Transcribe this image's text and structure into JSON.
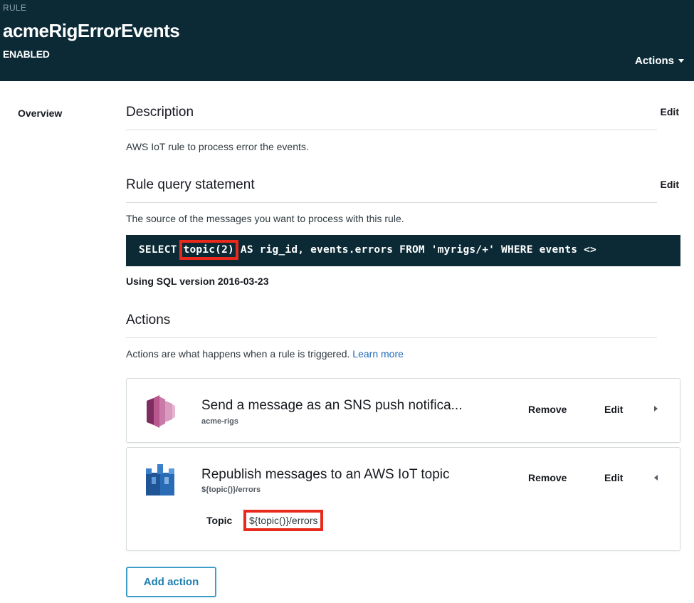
{
  "header": {
    "crumb": "RULE",
    "title": "acmeRigErrorEvents",
    "status": "ENABLED",
    "actions_label": "Actions"
  },
  "nav": {
    "overview": "Overview"
  },
  "description": {
    "title": "Description",
    "edit": "Edit",
    "text": "AWS IoT rule to process error the events."
  },
  "query": {
    "title": "Rule query statement",
    "edit": "Edit",
    "hint": "The source of the messages you want to process with this rule.",
    "sql_prefix": "SELECT ",
    "sql_highlight": "topic(2)",
    "sql_rest": " AS rig_id, events.errors FROM 'myrigs/+' WHERE events <>",
    "version": "Using SQL version 2016-03-23"
  },
  "actions": {
    "title": "Actions",
    "hint": "Actions are what happens when a rule is triggered.",
    "learn_more": "Learn more",
    "items": [
      {
        "title": "Send a message as an SNS push notifica...",
        "subtitle": "acme-rigs",
        "remove": "Remove",
        "edit": "Edit",
        "icon": "sns-icon"
      },
      {
        "title": "Republish messages to an AWS IoT topic",
        "subtitle": "${topic()}/errors",
        "remove": "Remove",
        "edit": "Edit",
        "icon": "iot-republish-icon",
        "topic_label": "Topic",
        "topic_value": "${topic()}/errors"
      }
    ],
    "add_button": "Add action"
  },
  "colors": {
    "header_bg": "#0b2a36",
    "highlight": "#e8291b",
    "link": "#1e6bb8",
    "sns_pink": "#b9578e",
    "iot_blue": "#3a7fc8"
  }
}
